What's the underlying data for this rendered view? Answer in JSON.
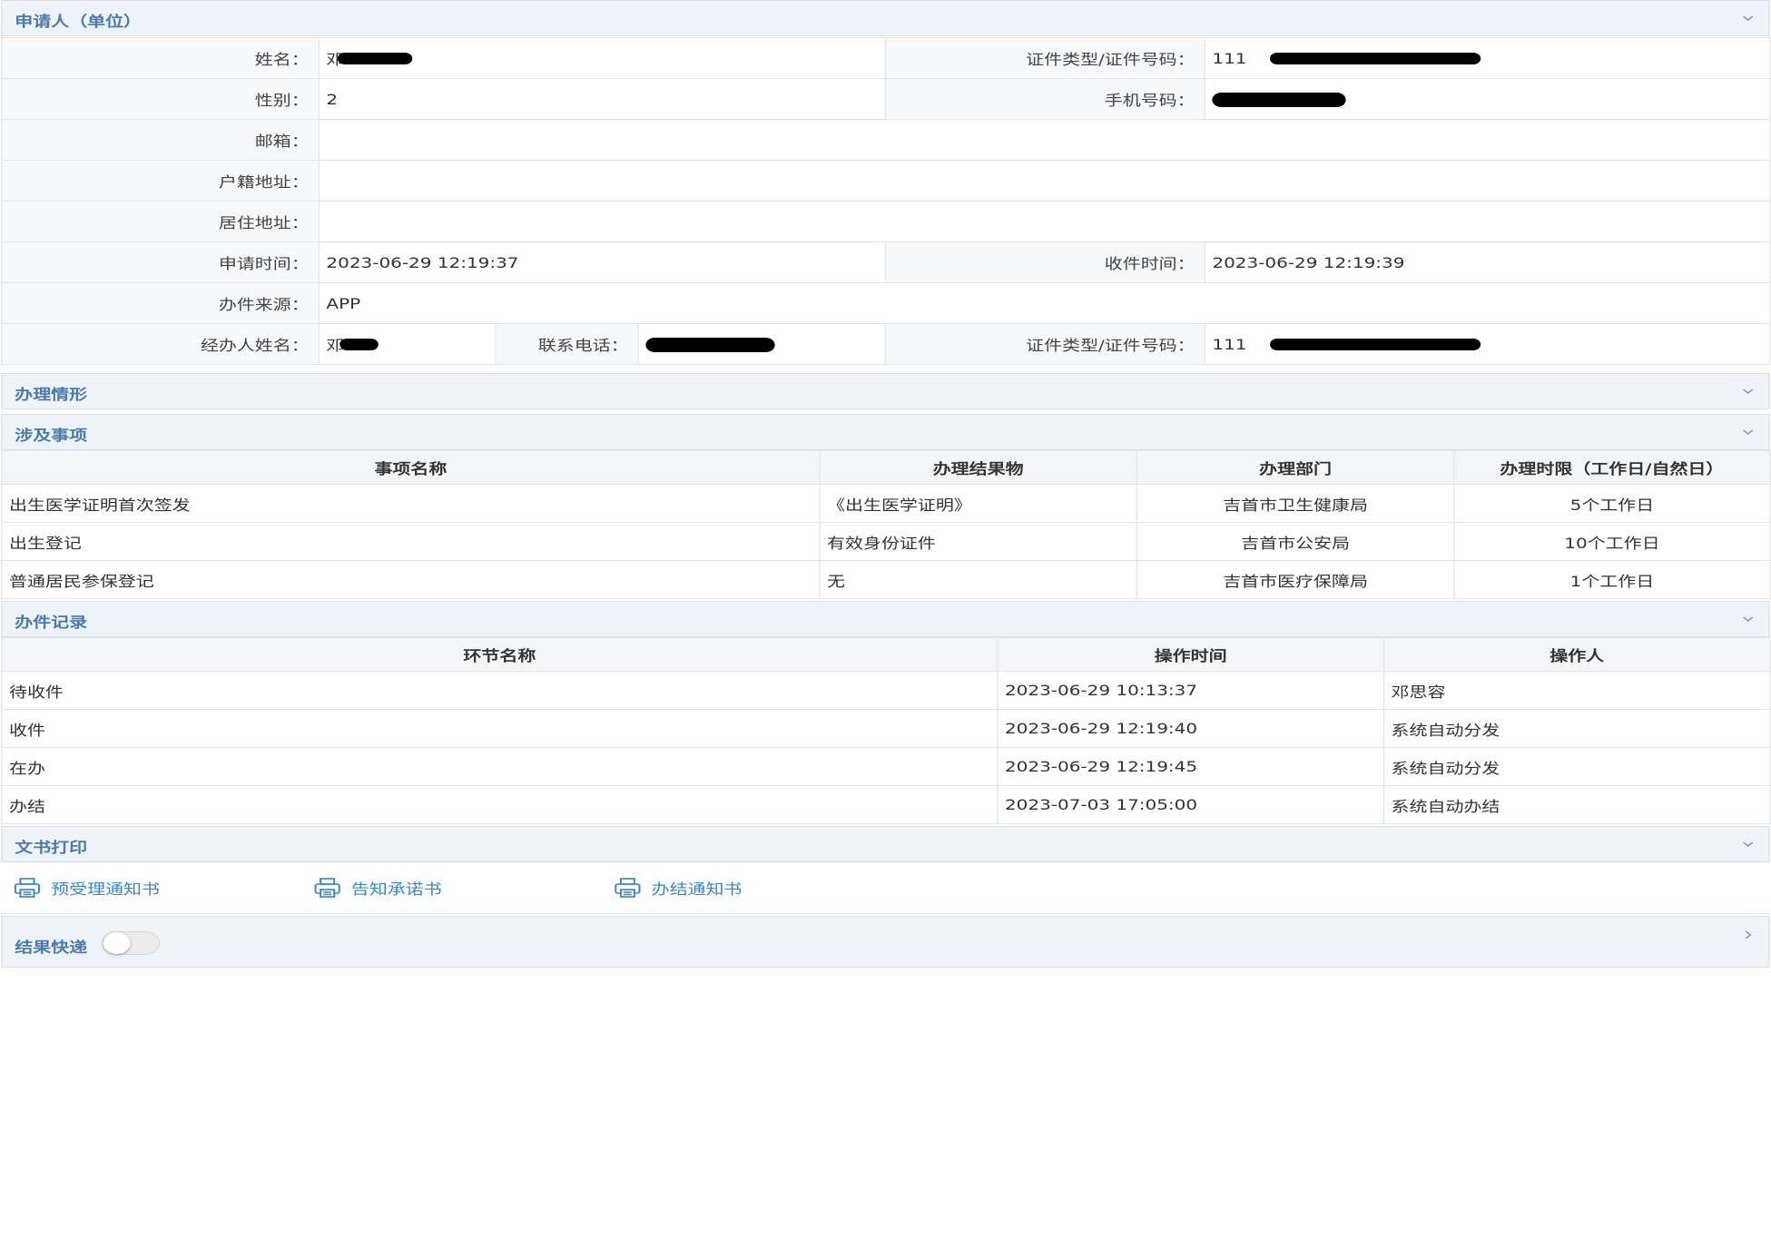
{
  "applicant": {
    "section_title": "申请人（单位）",
    "name_label": "姓名：",
    "name_value": "邓",
    "id_label": "证件类型/证件号码：",
    "id_value": "111",
    "gender_label": "性别：",
    "gender_value": "2",
    "phone_label": "手机号码：",
    "email_label": "邮箱：",
    "email_value": "",
    "household_label": "户籍地址：",
    "household_value": "",
    "residence_label": "居住地址：",
    "residence_value": "",
    "apply_time_label": "申请时间：",
    "apply_time_value": "2023-06-29 12:19:37",
    "receive_time_label": "收件时间：",
    "receive_time_value": "2023-06-29 12:19:39",
    "source_label": "办件来源：",
    "source_value": "APP",
    "agent_name_label": "经办人姓名：",
    "agent_name_value": "邓",
    "agent_phone_label": "联系电话：",
    "agent_id_label": "证件类型/证件号码：",
    "agent_id_value": "111"
  },
  "situation": {
    "section_title": "办理情形"
  },
  "matters": {
    "section_title": "涉及事项",
    "headers": [
      "事项名称",
      "办理结果物",
      "办理部门",
      "办理时限（工作日/自然日）"
    ],
    "rows": [
      [
        "出生医学证明首次签发",
        "《出生医学证明》",
        "吉首市卫生健康局",
        "5个工作日"
      ],
      [
        "出生登记",
        "有效身份证件",
        "吉首市公安局",
        "10个工作日"
      ],
      [
        "普通居民参保登记",
        "无",
        "吉首市医疗保障局",
        "1个工作日"
      ]
    ]
  },
  "records": {
    "section_title": "办件记录",
    "headers": [
      "环节名称",
      "操作时间",
      "操作人"
    ],
    "rows": [
      [
        "待收件",
        "2023-06-29 10:13:37",
        "邓思容"
      ],
      [
        "收件",
        "2023-06-29 12:19:40",
        "系统自动分发"
      ],
      [
        "在办",
        "2023-06-29 12:19:45",
        "系统自动分发"
      ],
      [
        "办结",
        "2023-07-03 17:05:00",
        "系统自动办结"
      ]
    ]
  },
  "print": {
    "section_title": "文书打印",
    "links": [
      "预受理通知书",
      "告知承诺书",
      "办结通知书"
    ],
    "icon": "printer-icon"
  },
  "express": {
    "section_title": "结果快递",
    "toggle_on": false
  },
  "colors": {
    "section_title": "#4a7ab0",
    "section_bg": "#eef3f9",
    "link": "#3a86c8",
    "label_bg": "#f7f8fa",
    "border": "#e2e6ea"
  }
}
